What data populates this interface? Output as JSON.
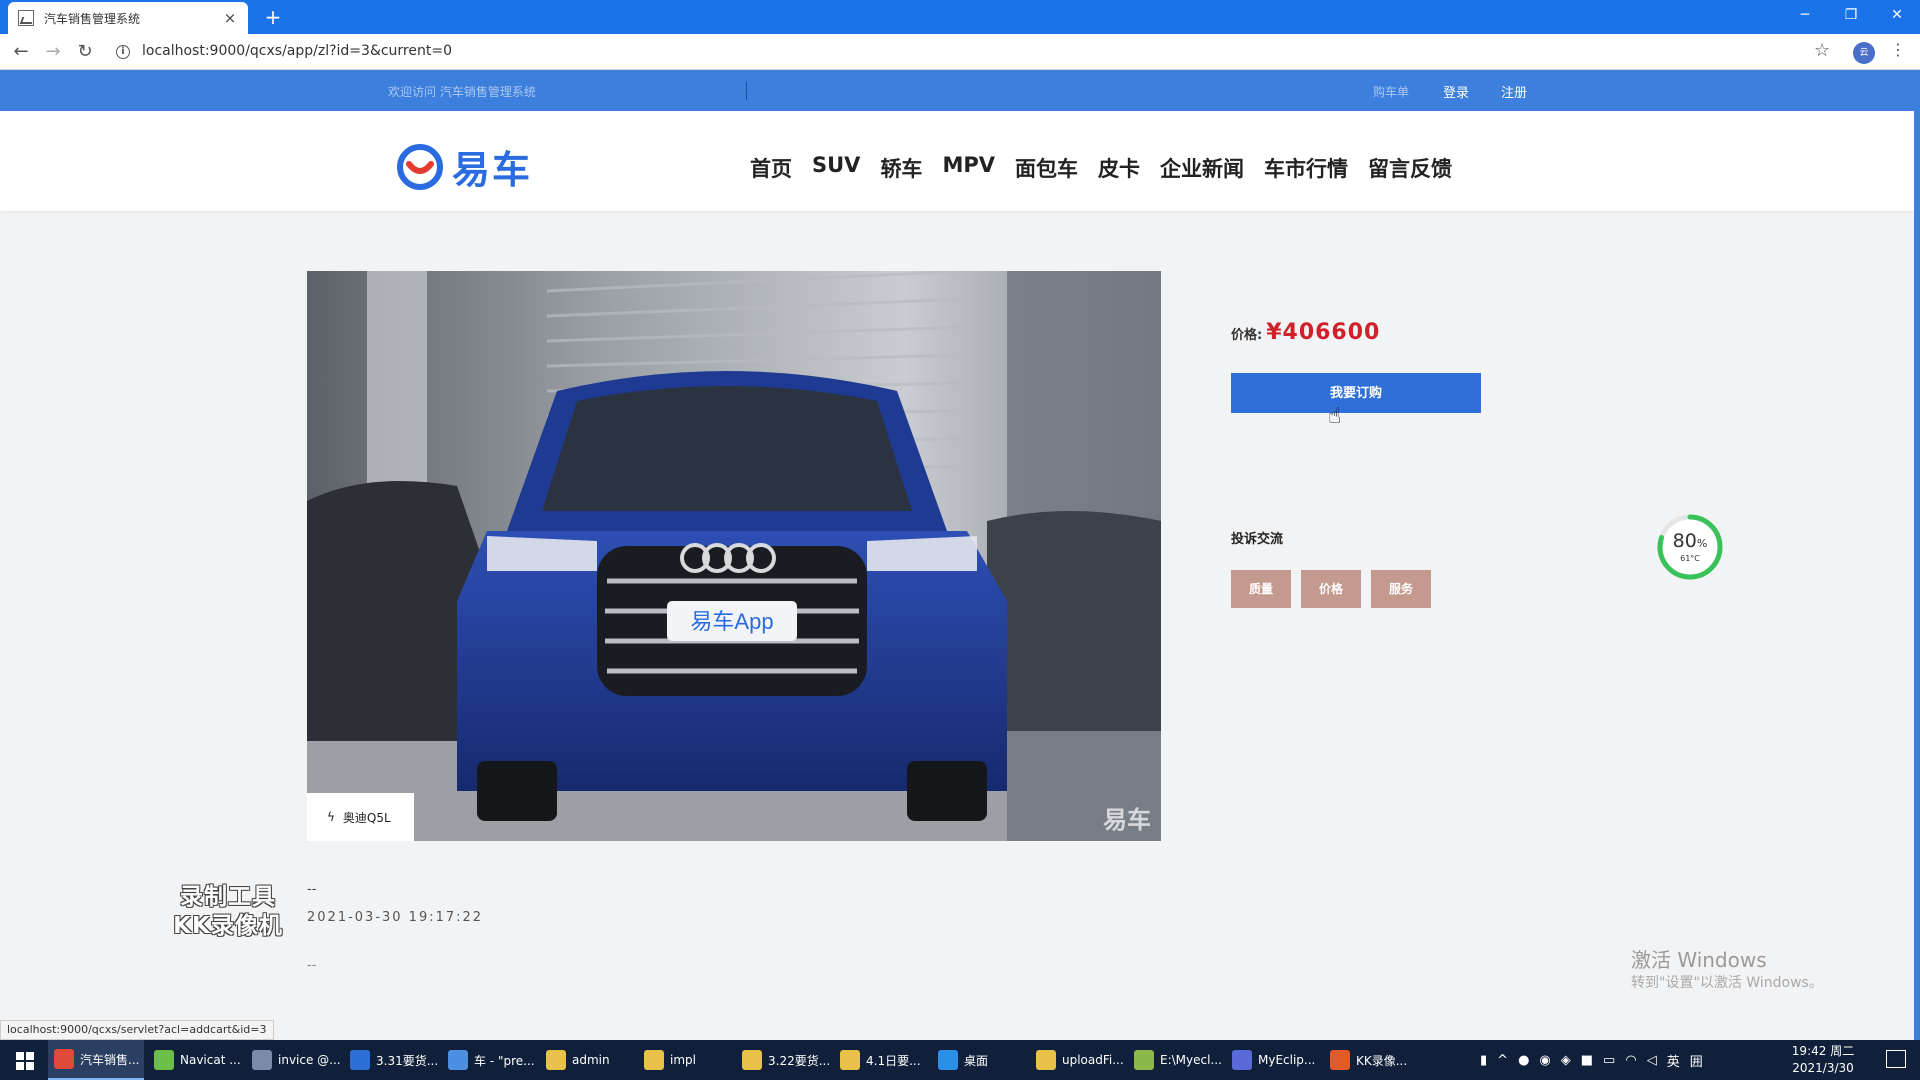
{
  "browser": {
    "tab_title": "汽车销售管理系统",
    "tab_close": "×",
    "new_tab": "+",
    "url": "localhost:9000/qcxs/app/zl?id=3&current=0",
    "status_url": "localhost:9000/qcxs/servlet?acl=addcart&id=3",
    "controls": {
      "minimize": "─",
      "maximize": "❐",
      "close": "✕"
    }
  },
  "topbar": {
    "welcome": "欢迎访问 汽车销售管理系统",
    "cart": "购车单",
    "login": "登录",
    "register": "注册"
  },
  "header": {
    "logo_text": "易车",
    "nav": [
      "首页",
      "SUV",
      "轿车",
      "MPV",
      "面包车",
      "皮卡",
      "企业新闻",
      "车市行情",
      "留言反馈"
    ]
  },
  "product": {
    "name": "奥迪Q5L",
    "photo_plate": "易车App",
    "photo_watermark": "易车",
    "price_label": "价格:",
    "price": "¥406600",
    "order_button": "我要订购",
    "complaint_title": "投诉交流",
    "complaints": [
      "质量",
      "价格",
      "服务"
    ]
  },
  "comment": {
    "author": "--",
    "date": "2021-03-30 19:17:22",
    "content": "--"
  },
  "overlay": {
    "gauge_percent": 80,
    "gauge_unit": "%",
    "gauge_temp": "61°C",
    "recorder_line1": "录制工具",
    "recorder_line2": "KK录像机",
    "activate_title": "激活 Windows",
    "activate_sub": "转到\"设置\"以激活 Windows。"
  },
  "taskbar": {
    "items": [
      {
        "label": "汽车销售...",
        "color": "#e04a3a"
      },
      {
        "label": "Navicat ...",
        "color": "#6cc04a"
      },
      {
        "label": "invice @...",
        "color": "#7a8aa8"
      },
      {
        "label": "3.31要货...",
        "color": "#2b6fd6"
      },
      {
        "label": "车 - \"pre...",
        "color": "#4a8fe0"
      },
      {
        "label": "admin",
        "color": "#e8c24a"
      },
      {
        "label": "impl",
        "color": "#e8c24a"
      },
      {
        "label": "3.22要货...",
        "color": "#e8c24a"
      },
      {
        "label": "4.1日要...",
        "color": "#e8c24a"
      },
      {
        "label": "桌面",
        "color": "#2a8fe6"
      },
      {
        "label": "uploadFi...",
        "color": "#e8c24a"
      },
      {
        "label": "E:\\Myecl...",
        "color": "#8ab84a"
      },
      {
        "label": "MyEclip...",
        "color": "#5a6ad8"
      },
      {
        "label": "KK录像...",
        "color": "#e05a2a"
      }
    ],
    "tray_lang": "英",
    "tray_ime": "囲",
    "time": "19:42 周二",
    "date": "2021/3/30"
  },
  "colors": {
    "brand_blue": "#2f6fd8",
    "topbar_blue": "#3d7fdc",
    "price_red": "#d0202a",
    "complaint_btn": "#c49a8f",
    "gauge_green": "#3ac25a"
  }
}
